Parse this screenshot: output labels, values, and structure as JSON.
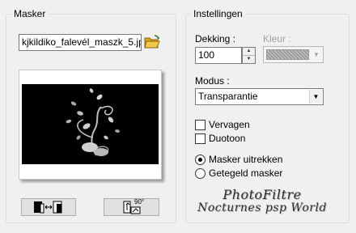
{
  "mask_group": {
    "legend": "Masker",
    "file_name": "kjkildiko_falevél_maszk_5.jp",
    "folder_icon": "folder-open-icon",
    "invert_icon": "invert-mask-icon",
    "rotate_icon": "rotate-90-icon",
    "rotate_label": "90°"
  },
  "settings_group": {
    "legend": "Instellingen",
    "opacity_label": "Dekking :",
    "opacity_value": "100",
    "color_label": "Kleur :",
    "mode_label": "Modus :",
    "mode_value": "Transparantie",
    "blur_label": "Vervagen",
    "duotone_label": "Duotoon",
    "stretch_label": "Masker uitrekken",
    "tile_label": "Getegeld masker"
  },
  "watermark": {
    "line1": "PhotoFiltre",
    "line2": "Nocturnes psp World"
  }
}
